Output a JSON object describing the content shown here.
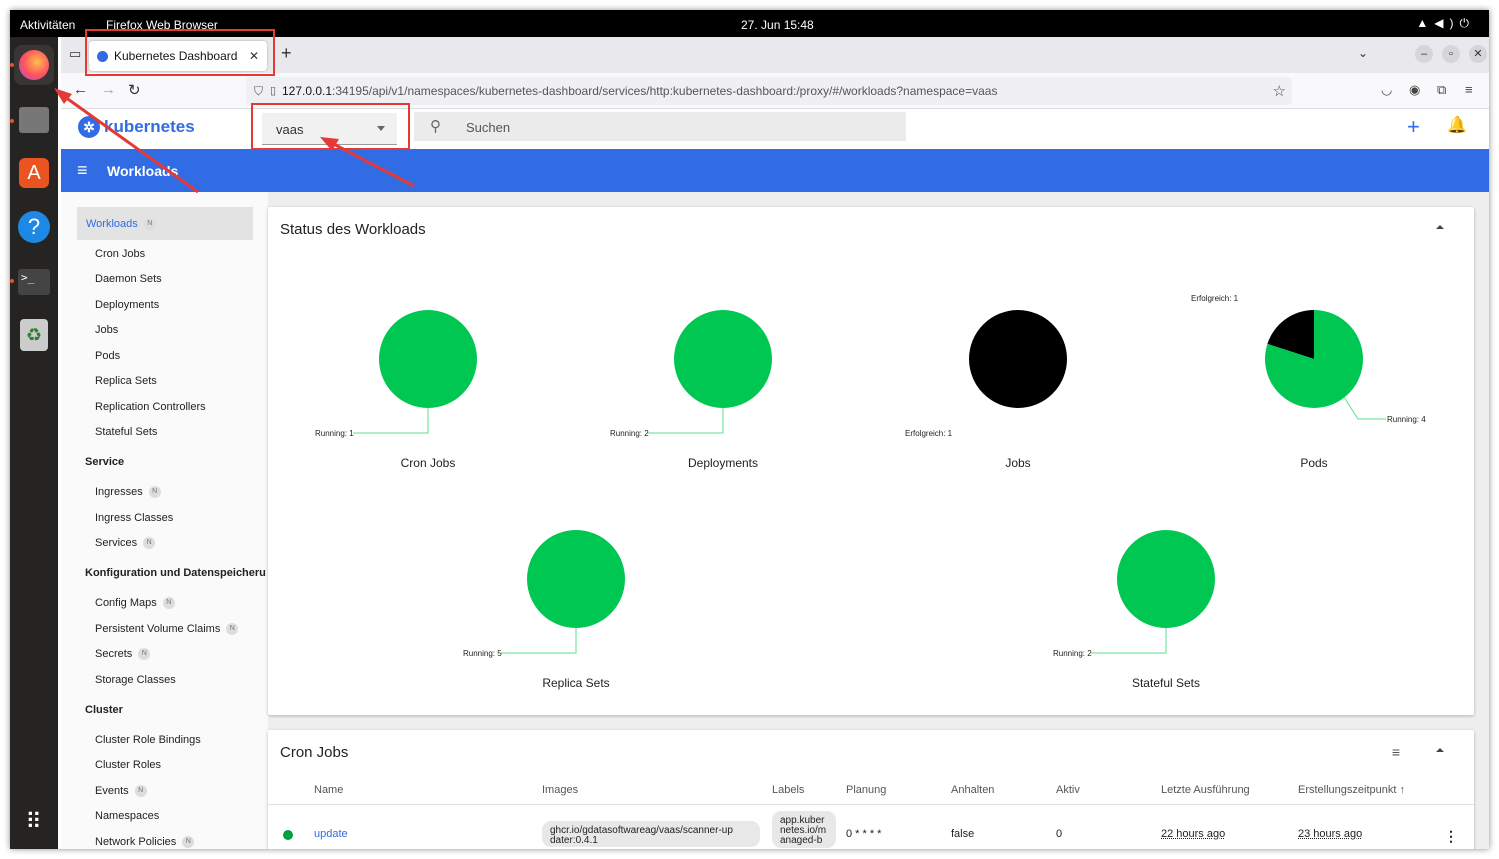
{
  "os": {
    "activities": "Aktivitäten",
    "app_name": "Firefox Web Browser",
    "clock": "27. Jun  15:48",
    "dock": [
      "firefox-icon",
      "files-icon",
      "app-center-icon",
      "help-icon",
      "terminal-icon",
      "trash-icon",
      "app-grid-icon"
    ]
  },
  "browser": {
    "tab_title": "Kubernetes Dashboard",
    "url_host": "127.0.0.1",
    "url_rest": ":34195/api/v1/namespaces/kubernetes-dashboard/services/http:kubernetes-dashboard:/proxy/#/workloads?namespace=vaas"
  },
  "dashboard": {
    "logo": "kubernetes",
    "namespace": "vaas",
    "search_placeholder": "Suchen",
    "page_title": "Workloads"
  },
  "sidebar": {
    "workloads": {
      "label": "Workloads",
      "badge": "N"
    },
    "workload_items": [
      "Cron Jobs",
      "Daemon Sets",
      "Deployments",
      "Jobs",
      "Pods",
      "Replica Sets",
      "Replication Controllers",
      "Stateful Sets"
    ],
    "service_head": "Service",
    "service_items": [
      {
        "label": "Ingresses",
        "badge": "N"
      },
      {
        "label": "Ingress Classes",
        "badge": ""
      },
      {
        "label": "Services",
        "badge": "N"
      }
    ],
    "config_head": "Konfiguration und Datenspeicheru",
    "config_items": [
      {
        "label": "Config Maps",
        "badge": "N"
      },
      {
        "label": "Persistent Volume Claims",
        "badge": "N"
      },
      {
        "label": "Secrets",
        "badge": "N"
      },
      {
        "label": "Storage Classes",
        "badge": ""
      }
    ],
    "cluster_head": "Cluster",
    "cluster_items": [
      {
        "label": "Cluster Role Bindings",
        "badge": ""
      },
      {
        "label": "Cluster Roles",
        "badge": ""
      },
      {
        "label": "Events",
        "badge": "N"
      },
      {
        "label": "Namespaces",
        "badge": ""
      },
      {
        "label": "Network Policies",
        "badge": "N"
      }
    ]
  },
  "status_card": {
    "title": "Status des Workloads",
    "charts": [
      {
        "name": "Cron Jobs",
        "slices": [
          {
            "label": "Running: 1",
            "value": 1,
            "color": "#00c752"
          }
        ]
      },
      {
        "name": "Deployments",
        "slices": [
          {
            "label": "Running: 2",
            "value": 2,
            "color": "#00c752"
          }
        ]
      },
      {
        "name": "Jobs",
        "slices": [
          {
            "label": "Erfolgreich: 1",
            "value": 1,
            "color": "#000000"
          }
        ]
      },
      {
        "name": "Pods",
        "slices": [
          {
            "label": "Running: 4",
            "value": 4,
            "color": "#00c752"
          },
          {
            "label": "Erfolgreich: 1",
            "value": 1,
            "color": "#000000"
          }
        ]
      },
      {
        "name": "Replica Sets",
        "slices": [
          {
            "label": "Running: 5",
            "value": 5,
            "color": "#00c752"
          }
        ]
      },
      {
        "name": "Stateful Sets",
        "slices": [
          {
            "label": "Running: 2",
            "value": 2,
            "color": "#00c752"
          }
        ]
      }
    ]
  },
  "cron_card": {
    "title": "Cron Jobs",
    "columns": [
      "Name",
      "Images",
      "Labels",
      "Planung",
      "Anhalten",
      "Aktiv",
      "Letzte Ausführung",
      "Erstellungszeitpunkt"
    ],
    "row": {
      "status_color": "#00a33b",
      "name": "update",
      "image_line1": "ghcr.io/gdatasoftwareag/vaas/scanner-up",
      "image_line2": "dater:0.4.1",
      "label_line1": "app.kuber",
      "label_line2": "netes.io/m",
      "label_line3": "anaged-b",
      "schedule": "0 * * * *",
      "suspend": "false",
      "active": "0",
      "last_run": "22 hours ago",
      "created": "23 hours ago"
    }
  },
  "colors": {
    "accent": "#326ce5",
    "annotation": "#e53935",
    "running": "#00c752",
    "succeeded": "#000000"
  }
}
